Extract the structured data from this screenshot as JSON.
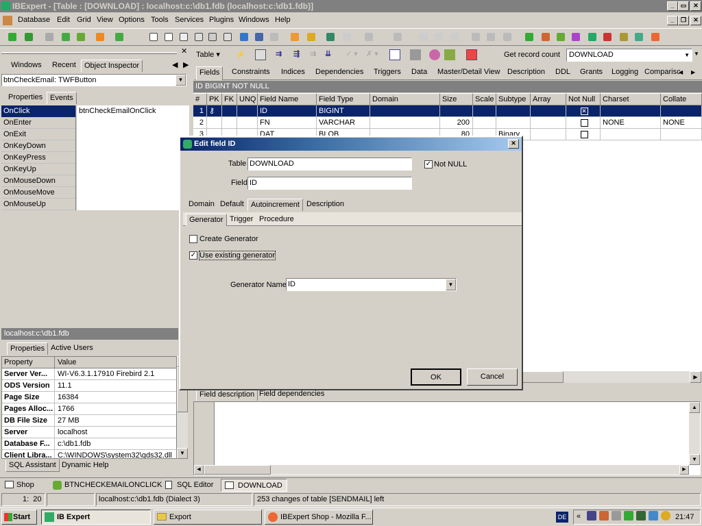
{
  "window": {
    "title": "IBExpert - [Table : [DOWNLOAD] : localhost:c:\\db1.fdb (localhost:c:\\db1.fdb)]"
  },
  "menu": [
    "Database",
    "Edit",
    "Grid",
    "View",
    "Options",
    "Tools",
    "Services",
    "Plugins",
    "Windows",
    "Help"
  ],
  "left_panel": {
    "tabs": [
      "Windows",
      "Recent",
      "Object Inspector"
    ],
    "component": "btnCheckEmail: TWFButton",
    "inspector_tabs": [
      "Properties",
      "Events"
    ],
    "events": [
      {
        "name": "OnClick",
        "value": "btnCheckEmailOnClick"
      },
      {
        "name": "OnEnter",
        "value": ""
      },
      {
        "name": "OnExit",
        "value": ""
      },
      {
        "name": "OnKeyDown",
        "value": ""
      },
      {
        "name": "OnKeyPress",
        "value": ""
      },
      {
        "name": "OnKeyUp",
        "value": ""
      },
      {
        "name": "OnMouseDown",
        "value": ""
      },
      {
        "name": "OnMouseMove",
        "value": ""
      },
      {
        "name": "OnMouseUp",
        "value": ""
      }
    ],
    "db_header": "localhost:c:\\db1.fdb",
    "db_tabs": [
      "Properties",
      "Active Users"
    ],
    "db_columns": [
      "Property",
      "Value"
    ],
    "db_props": [
      {
        "name": "Server Ver...",
        "value": "WI-V6.3.1.17910 Firebird 2.1"
      },
      {
        "name": "ODS Version",
        "value": "11.1"
      },
      {
        "name": "Page Size",
        "value": "16384"
      },
      {
        "name": "Pages Alloc...",
        "value": "1766"
      },
      {
        "name": "DB File Size",
        "value": "27 MB"
      },
      {
        "name": "Server",
        "value": "localhost"
      },
      {
        "name": "Database F...",
        "value": "c:\\db1.fdb"
      },
      {
        "name": "Client Libra...",
        "value": "C:\\WINDOWS\\system32\\gds32.dll"
      }
    ],
    "bottom_tabs": [
      "SQL Assistant",
      "Dynamic Help"
    ]
  },
  "table_toolbar": {
    "table_btn": "Table",
    "record_count": "Get record count",
    "table_select": "DOWNLOAD"
  },
  "table_tabs": [
    "Fields",
    "Constraints",
    "Indices",
    "Dependencies",
    "Triggers",
    "Data",
    "Master/Detail View",
    "Description",
    "DDL",
    "Grants",
    "Logging",
    "Comparisc"
  ],
  "field_header": "ID BIGINT NOT NULL",
  "grid": {
    "columns": [
      "#",
      "PK",
      "FK",
      "UNQ",
      "Field Name",
      "Field Type",
      "Domain",
      "Size",
      "Scale",
      "Subtype",
      "Array",
      "Not Null",
      "Charset",
      "Collate"
    ],
    "rows": [
      {
        "n": "1",
        "name": "ID",
        "type": "BIGINT",
        "size": "",
        "subtype": "",
        "notnull": "☒",
        "charset": "",
        "collate": ""
      },
      {
        "n": "2",
        "name": "FN",
        "type": "VARCHAR",
        "size": "200",
        "subtype": "",
        "notnull": "",
        "charset": "NONE",
        "collate": "NONE"
      },
      {
        "n": "3",
        "name": "DAT",
        "type": "BLOB",
        "size": "80",
        "subtype": "Binary",
        "notnull": "",
        "charset": "",
        "collate": ""
      }
    ]
  },
  "desc_tabs": [
    "Field description",
    "Field dependencies"
  ],
  "dialog": {
    "title": "Edit field ID",
    "table_label": "Table",
    "table_value": "DOWNLOAD",
    "field_label": "Field",
    "field_value": "ID",
    "notnull_label": "Not NULL",
    "tabs": [
      "Domain",
      "Default",
      "Autoincrement",
      "Description"
    ],
    "subtabs": [
      "Generator",
      "Trigger",
      "Procedure"
    ],
    "create_gen": "Create Generator",
    "use_existing": "Use existing generator",
    "gen_name_label": "Generator Name",
    "gen_name_value": "ID",
    "ok": "OK",
    "cancel": "Cancel"
  },
  "window_tabs": [
    "Shop",
    "BTNCHECKEMAILONCLICK",
    "SQL Editor",
    "DOWNLOAD"
  ],
  "status": {
    "pos": "1:  20",
    "db": "localhost:c:\\db1.fdb (Dialect 3)",
    "msg": "253 changes of table [SENDMAIL] left"
  },
  "taskbar": {
    "start": "Start",
    "tasks": [
      "IB Expert",
      "Export",
      "IBExpert Shop - Mozilla F..."
    ],
    "lang": "DE",
    "clock": "21:47"
  }
}
